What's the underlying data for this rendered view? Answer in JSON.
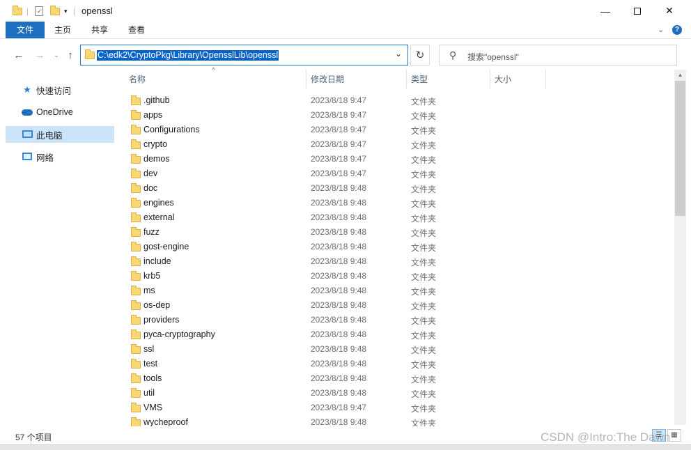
{
  "window": {
    "title": "openssl",
    "minimize_icon": "minimize-icon",
    "maximize_icon": "maximize-icon",
    "close_icon": "close-icon"
  },
  "ribbon": {
    "tabs": [
      "文件",
      "主页",
      "共享",
      "查看"
    ]
  },
  "address": {
    "path": "C:\\edk2\\CryptoPkg\\Library\\OpensslLib\\openssl"
  },
  "search": {
    "placeholder": "搜索\"openssl\""
  },
  "nav": {
    "items": [
      {
        "label": "快速访问",
        "icon": "star-icon"
      },
      {
        "label": "OneDrive",
        "icon": "cloud-icon"
      },
      {
        "label": "此电脑",
        "icon": "computer-icon"
      },
      {
        "label": "网络",
        "icon": "network-icon"
      }
    ]
  },
  "columns": {
    "name": "名称",
    "date": "修改日期",
    "type": "类型",
    "size": "大小"
  },
  "files": [
    {
      "name": ".github",
      "date": "2023/8/18 9:47",
      "type": "文件夹"
    },
    {
      "name": "apps",
      "date": "2023/8/18 9:47",
      "type": "文件夹"
    },
    {
      "name": "Configurations",
      "date": "2023/8/18 9:47",
      "type": "文件夹"
    },
    {
      "name": "crypto",
      "date": "2023/8/18 9:47",
      "type": "文件夹"
    },
    {
      "name": "demos",
      "date": "2023/8/18 9:47",
      "type": "文件夹"
    },
    {
      "name": "dev",
      "date": "2023/8/18 9:47",
      "type": "文件夹"
    },
    {
      "name": "doc",
      "date": "2023/8/18 9:48",
      "type": "文件夹"
    },
    {
      "name": "engines",
      "date": "2023/8/18 9:48",
      "type": "文件夹"
    },
    {
      "name": "external",
      "date": "2023/8/18 9:48",
      "type": "文件夹"
    },
    {
      "name": "fuzz",
      "date": "2023/8/18 9:48",
      "type": "文件夹"
    },
    {
      "name": "gost-engine",
      "date": "2023/8/18 9:48",
      "type": "文件夹"
    },
    {
      "name": "include",
      "date": "2023/8/18 9:48",
      "type": "文件夹"
    },
    {
      "name": "krb5",
      "date": "2023/8/18 9:48",
      "type": "文件夹"
    },
    {
      "name": "ms",
      "date": "2023/8/18 9:48",
      "type": "文件夹"
    },
    {
      "name": "os-dep",
      "date": "2023/8/18 9:48",
      "type": "文件夹"
    },
    {
      "name": "providers",
      "date": "2023/8/18 9:48",
      "type": "文件夹"
    },
    {
      "name": "pyca-cryptography",
      "date": "2023/8/18 9:48",
      "type": "文件夹"
    },
    {
      "name": "ssl",
      "date": "2023/8/18 9:48",
      "type": "文件夹"
    },
    {
      "name": "test",
      "date": "2023/8/18 9:48",
      "type": "文件夹"
    },
    {
      "name": "tools",
      "date": "2023/8/18 9:48",
      "type": "文件夹"
    },
    {
      "name": "util",
      "date": "2023/8/18 9:48",
      "type": "文件夹"
    },
    {
      "name": "VMS",
      "date": "2023/8/18 9:47",
      "type": "文件夹"
    },
    {
      "name": "wycheproof",
      "date": "2023/8/18 9:48",
      "type": "文件夹"
    }
  ],
  "status": {
    "count": "57 个项目"
  },
  "watermark": "CSDN @Intro:The Dawn",
  "colors": {
    "accent": "#1e6fbf",
    "selection": "#cce4f7",
    "folder": "#f8d775"
  }
}
